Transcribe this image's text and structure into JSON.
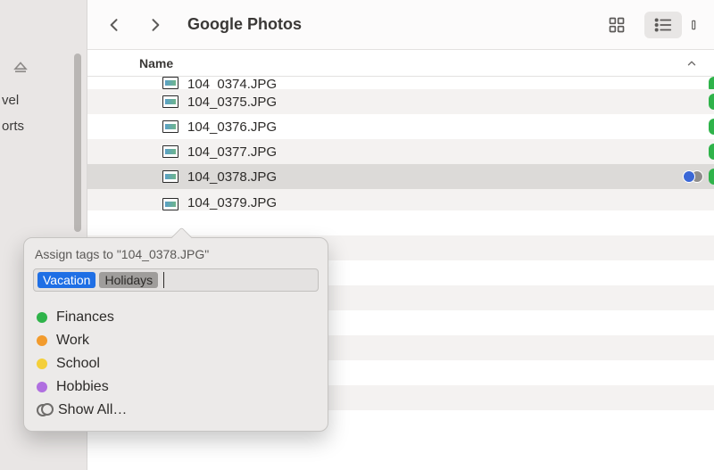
{
  "toolbar": {
    "title": "Google Photos"
  },
  "sidebar": {
    "items": [
      "vel",
      "orts"
    ]
  },
  "list": {
    "header": "Name",
    "rows": [
      {
        "name": "104_0374.JPG"
      },
      {
        "name": "104_0375.JPG"
      },
      {
        "name": "104_0376.JPG"
      },
      {
        "name": "104_0377.JPG"
      },
      {
        "name": "104_0378.JPG"
      },
      {
        "name": "104_0379.JPG"
      }
    ]
  },
  "popover": {
    "title": "Assign tags to \"104_0378.JPG\"",
    "tokens": [
      "Vacation",
      "Holidays"
    ],
    "options": [
      {
        "label": "Finances",
        "color": "green"
      },
      {
        "label": "Work",
        "color": "orange"
      },
      {
        "label": "School",
        "color": "yellow"
      },
      {
        "label": "Hobbies",
        "color": "purple"
      }
    ],
    "show_all": "Show All…"
  }
}
